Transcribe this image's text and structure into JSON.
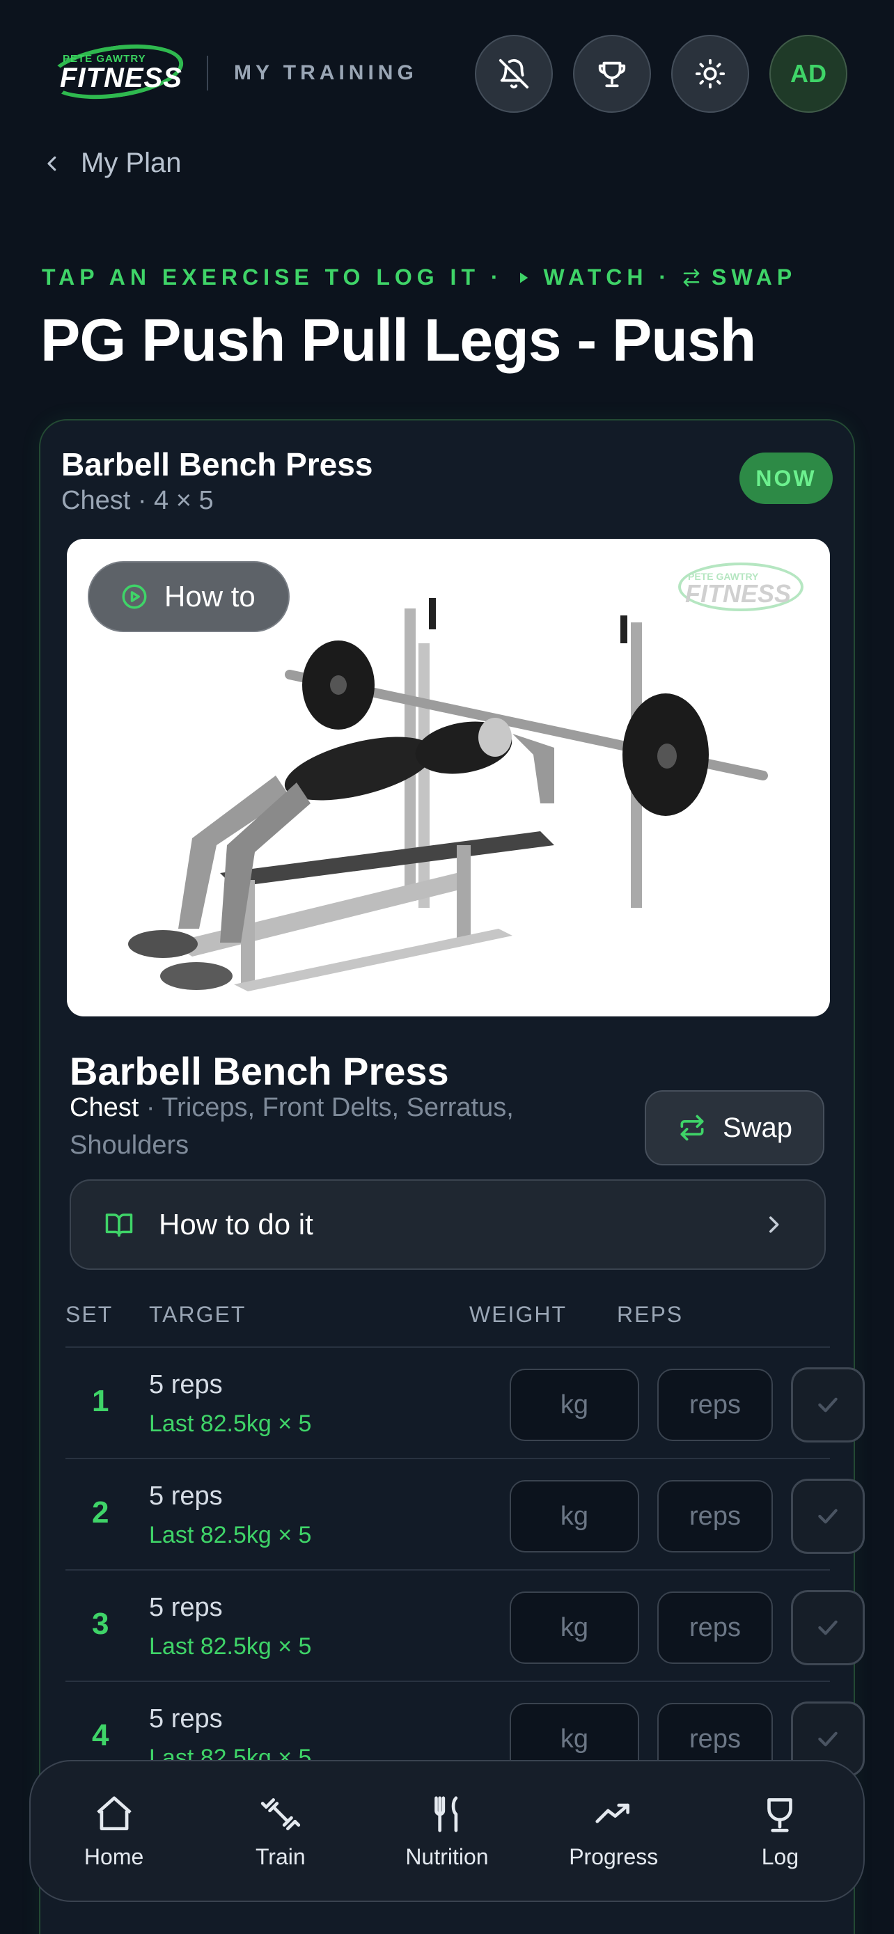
{
  "header": {
    "logo_small": "PETE GAWTRY",
    "logo_big": "FITNESS",
    "section": "MY TRAINING",
    "avatar": "AD"
  },
  "nav": {
    "back_label": "My Plan"
  },
  "hint": {
    "lead": "TAP AN EXERCISE TO LOG IT ·",
    "watch": "WATCH ·",
    "swap": "SWAP"
  },
  "title": "PG Push Pull Legs - Push",
  "card": {
    "title": "Barbell Bench Press",
    "subtitle": "Chest · 4 × 5",
    "badge": "NOW",
    "howto_label": "How to",
    "exercise_name": "Barbell Bench Press",
    "primary_muscle": "Chest",
    "secondary_muscles": "· Triceps, Front Delts, Serratus, Shoulders",
    "swap_label": "Swap",
    "howdo_label": "How to do it"
  },
  "table": {
    "headers": {
      "set": "SET",
      "target": "TARGET",
      "weight": "WEIGHT",
      "reps": "REPS"
    },
    "rows": [
      {
        "set": "1",
        "target": "5 reps",
        "last": "Last 82.5kg × 5",
        "kg_ph": "kg",
        "reps_ph": "reps"
      },
      {
        "set": "2",
        "target": "5 reps",
        "last": "Last 82.5kg × 5",
        "kg_ph": "kg",
        "reps_ph": "reps"
      },
      {
        "set": "3",
        "target": "5 reps",
        "last": "Last 82.5kg × 5",
        "kg_ph": "kg",
        "reps_ph": "reps"
      },
      {
        "set": "4",
        "target": "5 reps",
        "last": "Last 82.5kg × 5",
        "kg_ph": "kg",
        "reps_ph": "reps"
      }
    ]
  },
  "bottom_nav": [
    {
      "label": "Home",
      "icon": "home-icon"
    },
    {
      "label": "Train",
      "icon": "dumbbell-icon"
    },
    {
      "label": "Nutrition",
      "icon": "fork-knife-icon"
    },
    {
      "label": "Progress",
      "icon": "trend-icon"
    },
    {
      "label": "Log",
      "icon": "trophy-icon"
    }
  ],
  "colors": {
    "accent": "#3fd468",
    "background": "#0c131d",
    "card": "#121b27"
  }
}
